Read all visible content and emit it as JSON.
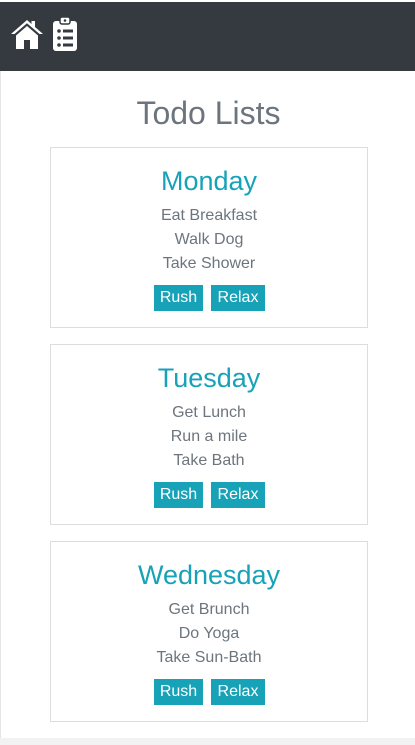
{
  "navbar": {
    "home_icon": "home-icon",
    "todo_icon": "clipboard-list-icon"
  },
  "page": {
    "title": "Todo Lists"
  },
  "lists": [
    {
      "day": "Monday",
      "tasks": [
        "Eat Breakfast",
        "Walk Dog",
        "Take Shower"
      ],
      "rush_label": "Rush",
      "relax_label": "Relax"
    },
    {
      "day": "Tuesday",
      "tasks": [
        "Get Lunch",
        "Run a mile",
        "Take Bath"
      ],
      "rush_label": "Rush",
      "relax_label": "Relax"
    },
    {
      "day": "Wednesday",
      "tasks": [
        "Get Brunch",
        "Do Yoga",
        "Take Sun-Bath"
      ],
      "rush_label": "Rush",
      "relax_label": "Relax"
    }
  ],
  "colors": {
    "navbar": "#343a40",
    "accent": "#17a2b8",
    "muted_text": "#6c757d"
  }
}
